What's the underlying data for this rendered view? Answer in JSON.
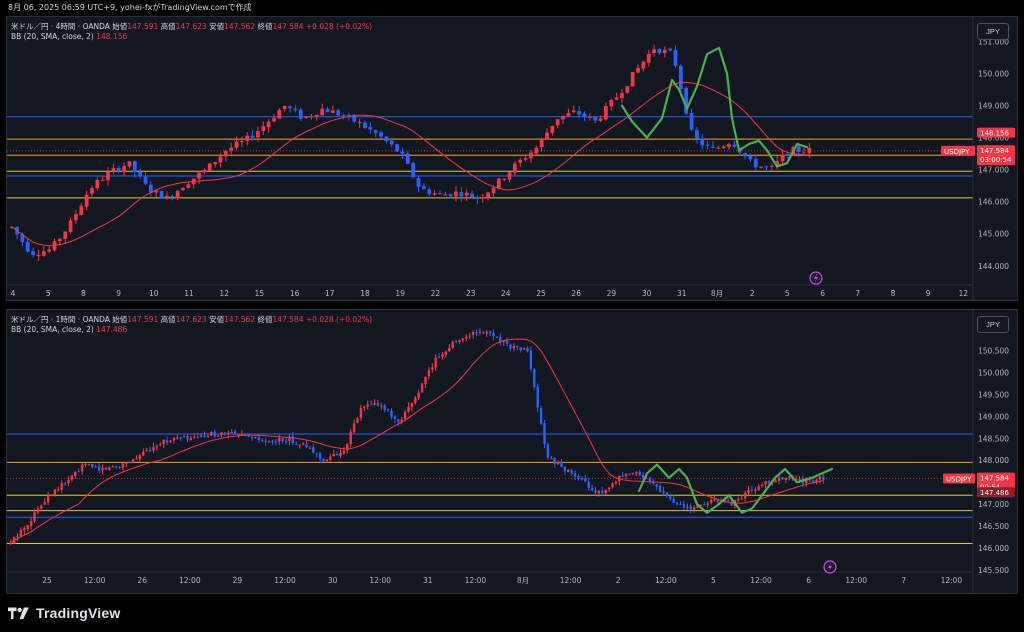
{
  "header": {
    "caption": "8月 06, 2025 06:59 UTC+9,  yohei-fxがTradingView.comで作成"
  },
  "colors": {
    "bg": "#131722",
    "up": "#f23645",
    "down": "#2962ff",
    "bb": "#f23645",
    "blue_line": "#2962ff",
    "orange_line": "#f7a21b",
    "yellow_line": "#d9c74a",
    "green_path": "#4caf50"
  },
  "panel1": {
    "symbol": "米ドル／円 · 4時間 · OANDA",
    "open_label": "始値",
    "open": "147.591",
    "high_label": "高値",
    "high": "147.623",
    "low_label": "安値",
    "low": "147.562",
    "close_label": "終値",
    "close": "147.584",
    "change": "+0.028 (+0.02%)",
    "bb_label": "BB (20, SMA, close, 2)",
    "bb_value": "148.156",
    "currency": "JPY",
    "price_ticks": [
      "151.000",
      "150.000",
      "149.000",
      "148.000",
      "147.000",
      "146.000",
      "145.000",
      "144.000"
    ],
    "time_ticks": [
      "4",
      "5",
      "8",
      "9",
      "10",
      "11",
      "12",
      "15",
      "16",
      "17",
      "18",
      "19",
      "22",
      "23",
      "24",
      "25",
      "26",
      "29",
      "30",
      "31",
      "8月",
      "2",
      "5",
      "6",
      "7",
      "8",
      "9",
      "12"
    ],
    "tag_bb": "148.156",
    "tag_symbol": "USDJPY",
    "tag_price": "147.584",
    "tag_countdown": "03:00:54"
  },
  "panel2": {
    "symbol": "米ドル／円 · 1時間 · OANDA",
    "open_label": "始値",
    "open": "147.591",
    "high_label": "高値",
    "high": "147.623",
    "low_label": "安値",
    "low": "147.562",
    "close_label": "終値",
    "close": "147.584",
    "change": "+0.028 (+0.02%)",
    "bb_label": "BB (20, SMA, close, 2)",
    "bb_value": "147.486",
    "currency": "JPY",
    "price_ticks": [
      "151.000",
      "150.500",
      "150.000",
      "149.500",
      "149.000",
      "148.500",
      "148.000",
      "147.500",
      "147.000",
      "146.500",
      "146.000",
      "145.500"
    ],
    "time_ticks": [
      "25",
      "12:00",
      "26",
      "12:00",
      "29",
      "12:00",
      "30",
      "12:00",
      "31",
      "12:00",
      "8月",
      "12:00",
      "2",
      "12:00",
      "5",
      "12:00",
      "6",
      "12:00",
      "7",
      "12:00"
    ],
    "tag_symbol": "USDJPY",
    "tag_price": "147.584",
    "tag_countdown": "00:54",
    "tag_bb": "147.486"
  },
  "footer": {
    "brand": "TradingView"
  }
}
